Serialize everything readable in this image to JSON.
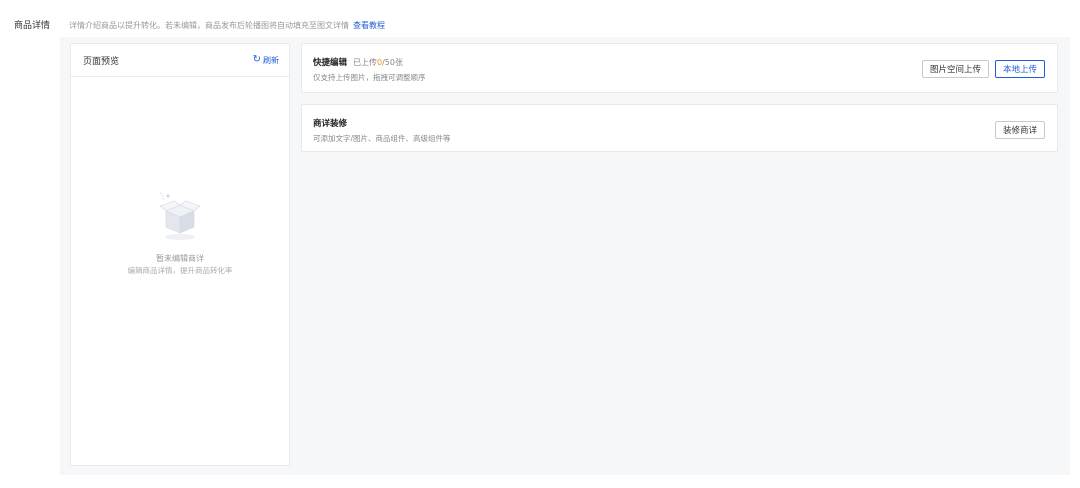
{
  "section": {
    "label": "商品详情",
    "tip_text": "详情介绍商品以提升转化。若未编辑，商品发布后轮播图将自动填充至图文详情",
    "tip_link": "查看教程"
  },
  "preview": {
    "title": "页面预览",
    "refresh_label": "刷新",
    "refresh_icon": "refresh-icon",
    "empty_title": "暂未编辑商详",
    "empty_subtitle": "编辑商品详情，提升商品转化率"
  },
  "quick_edit": {
    "title": "快捷编辑",
    "counter_prefix": "已上传",
    "counter_value": "0",
    "counter_suffix": "/50张",
    "description": "仅支持上传图片，拖拽可调整顺序",
    "btn_space_upload": "图片空间上传",
    "btn_local_upload": "本地上传"
  },
  "decor": {
    "title": "商详装修",
    "description": "可添加文字/图片、商品组件、高级组件等",
    "btn_decorate": "装修商详"
  },
  "colors": {
    "accent": "#1e5bd6",
    "counter_highlight": "#ff8a00",
    "panel_bg": "#f6f7f9"
  }
}
